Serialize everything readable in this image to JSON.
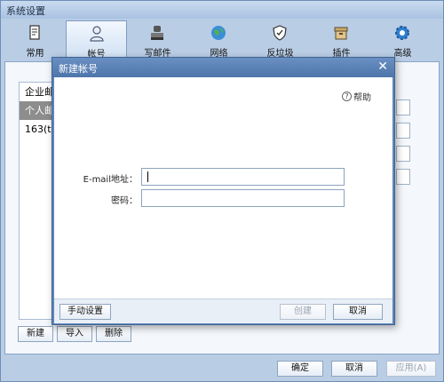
{
  "window": {
    "title": "系统设置"
  },
  "toolbar": {
    "items": [
      {
        "label": "常用",
        "icon": "document-icon"
      },
      {
        "label": "帐号",
        "icon": "user-icon"
      },
      {
        "label": "写邮件",
        "icon": "stamp-icon"
      },
      {
        "label": "网络",
        "icon": "globe-icon"
      },
      {
        "label": "反垃圾",
        "icon": "shield-icon"
      },
      {
        "label": "插件",
        "icon": "box-icon"
      },
      {
        "label": "高级",
        "icon": "gear-icon"
      }
    ]
  },
  "accounts": {
    "items": [
      {
        "label": "企业邮"
      },
      {
        "label": "个人邮"
      },
      {
        "label": "163(te"
      }
    ]
  },
  "account_buttons": {
    "new": "新建",
    "import": "导入",
    "delete": "删除"
  },
  "footer": {
    "ok": "确定",
    "cancel": "取消",
    "apply": "应用(A)"
  },
  "dialog": {
    "title": "新建帐号",
    "help": "帮助",
    "email_label": "E-mail地址：",
    "email_value": "",
    "password_label": "密码：",
    "password_value": "",
    "manual_button": "手动设置",
    "create_button": "创建",
    "cancel_button": "取消"
  },
  "colors": {
    "accent": "#5f85b8",
    "selected_row": "#8d8d8d"
  }
}
